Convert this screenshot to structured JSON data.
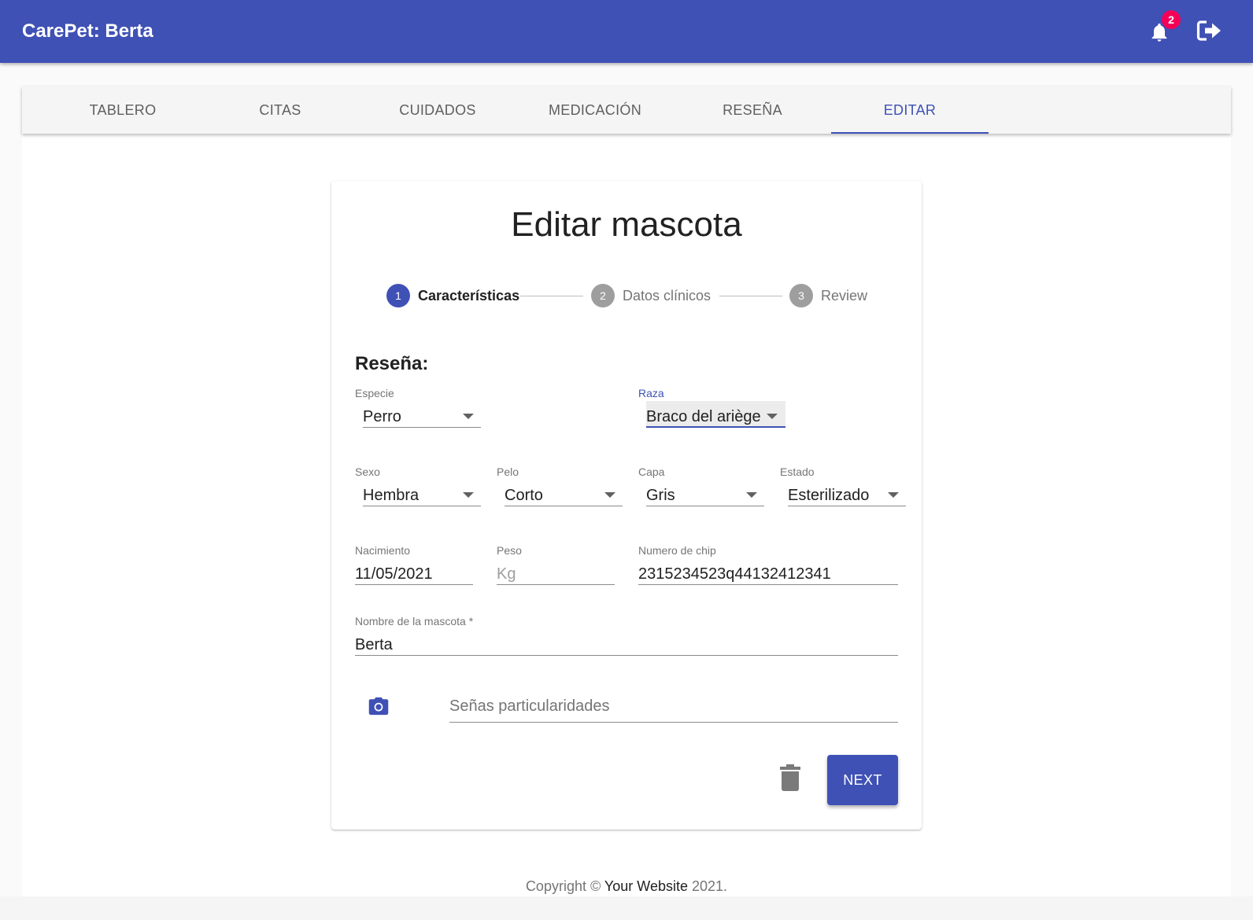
{
  "app": {
    "title": "CarePet: Berta",
    "notification_count": "2"
  },
  "colors": {
    "primary": "#3f51b5",
    "badge": "#f50057",
    "step_inactive": "#9e9e9e"
  },
  "icons": {
    "notifications": "bell-icon",
    "logout": "logout-icon",
    "photo": "camera-icon",
    "delete": "trash-icon"
  },
  "tabs": [
    {
      "label": "TABLERO",
      "active": false
    },
    {
      "label": "CITAS",
      "active": false
    },
    {
      "label": "CUIDADOS",
      "active": false
    },
    {
      "label": "MEDICACIÓN",
      "active": false
    },
    {
      "label": "RESEÑA",
      "active": false
    },
    {
      "label": "EDITAR",
      "active": true
    }
  ],
  "form": {
    "title": "Editar mascota",
    "steps": [
      {
        "number": "1",
        "label": "Características",
        "active": true
      },
      {
        "number": "2",
        "label": "Datos clínicos",
        "active": false
      },
      {
        "number": "3",
        "label": "Review",
        "active": false
      }
    ],
    "section_title": "Reseña:",
    "fields": {
      "especie": {
        "label": "Especie",
        "value": "Perro"
      },
      "raza": {
        "label": "Raza",
        "value": "Braco del ariège"
      },
      "sexo": {
        "label": "Sexo",
        "value": "Hembra"
      },
      "pelo": {
        "label": "Pelo",
        "value": "Corto"
      },
      "capa": {
        "label": "Capa",
        "value": "Gris"
      },
      "estado": {
        "label": "Estado",
        "value": "Esterilizado"
      },
      "nacimiento": {
        "label": "Nacimiento",
        "value": "11/05/2021"
      },
      "peso": {
        "label": "Peso",
        "value": "",
        "placeholder": "Kg"
      },
      "chip": {
        "label": "Numero de chip",
        "value": "2315234523q44132412341"
      },
      "nombre": {
        "label": "Nombre de la mascota *",
        "value": "Berta"
      },
      "senas": {
        "label": "",
        "value": "",
        "placeholder": "Señas particularidades"
      }
    },
    "next_label": "NEXT"
  },
  "footer": {
    "prefix": "Copyright © ",
    "link": "Your Website",
    "suffix": " 2021."
  }
}
